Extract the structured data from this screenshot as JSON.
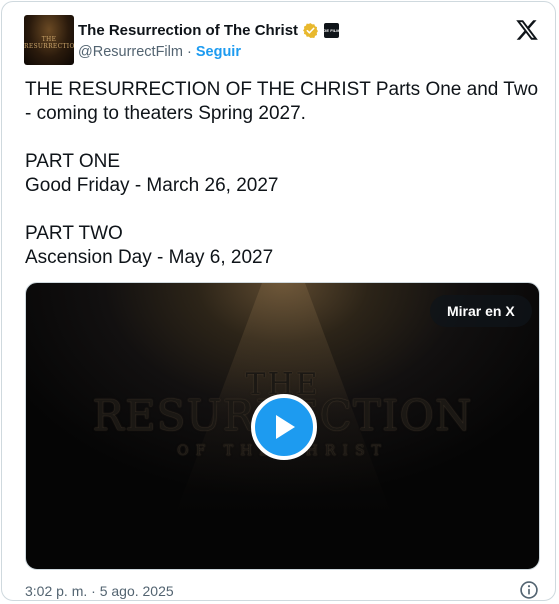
{
  "author": {
    "display_name": "The Resurrection of The Christ",
    "handle": "@ResurrectFilm",
    "separator": "·",
    "follow_label": "Seguir",
    "avatar_text": "THE RESURRECTION",
    "verified_color": "#e8b82d",
    "affiliate_badge_text": "LGE FILMS"
  },
  "tweet": {
    "text": "THE RESURRECTION OF THE CHRIST Parts One and Two - coming to theaters Spring 2027.\n\nPART ONE\nGood Friday - March 26, 2027\n\nPART TWO\nAscension Day - May 6, 2027"
  },
  "media": {
    "watch_label": "Mirar en X",
    "title_line1": "THE",
    "title_line2": "RESURRECTION",
    "title_line3": "OF THE CHRIST"
  },
  "footer": {
    "timestamp": "3:02 p. m. · 5 ago. 2025"
  },
  "colors": {
    "link": "#1d9bf0",
    "secondary_text": "#536471",
    "primary_text": "#0f1419",
    "border": "#cfd9de"
  }
}
